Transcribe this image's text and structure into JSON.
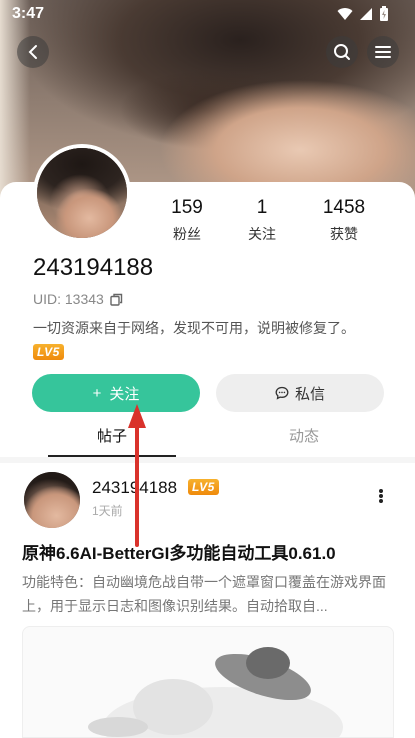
{
  "status_bar": {
    "time": "3:47"
  },
  "profile": {
    "username": "243194188",
    "uid": "UID: 13343",
    "bio": "一切资源来自于网络，发现不可用，说明被修复了。",
    "level": "LV5",
    "stats": [
      {
        "value": "159",
        "label": "粉丝"
      },
      {
        "value": "1",
        "label": "关注"
      },
      {
        "value": "1458",
        "label": "获赞"
      }
    ],
    "follow_label": "关注",
    "follow_plus": "+",
    "message_label": "私信"
  },
  "tabs": [
    {
      "label": "帖子",
      "active": true
    },
    {
      "label": "动态",
      "active": false
    }
  ],
  "post": {
    "author": "243194188",
    "level": "LV5",
    "time": "1天前",
    "title": "原神6.6AI-BetterGI多功能自动工具0.61.0",
    "excerpt": "功能特色：自动幽境危战自带一个遮罩窗口覆盖在游戏界面上，用于显示日志和图像识别结果。自动拾取自..."
  },
  "colors": {
    "accent": "#36c59b",
    "annotation_arrow": "#d9322b",
    "level_badge": "#f39a16"
  },
  "icons": {
    "back": "chevron-left-icon",
    "search": "search-icon",
    "menu": "menu-icon",
    "copy": "copy-icon",
    "message": "chat-bubble-icon",
    "more": "more-vertical-icon"
  }
}
